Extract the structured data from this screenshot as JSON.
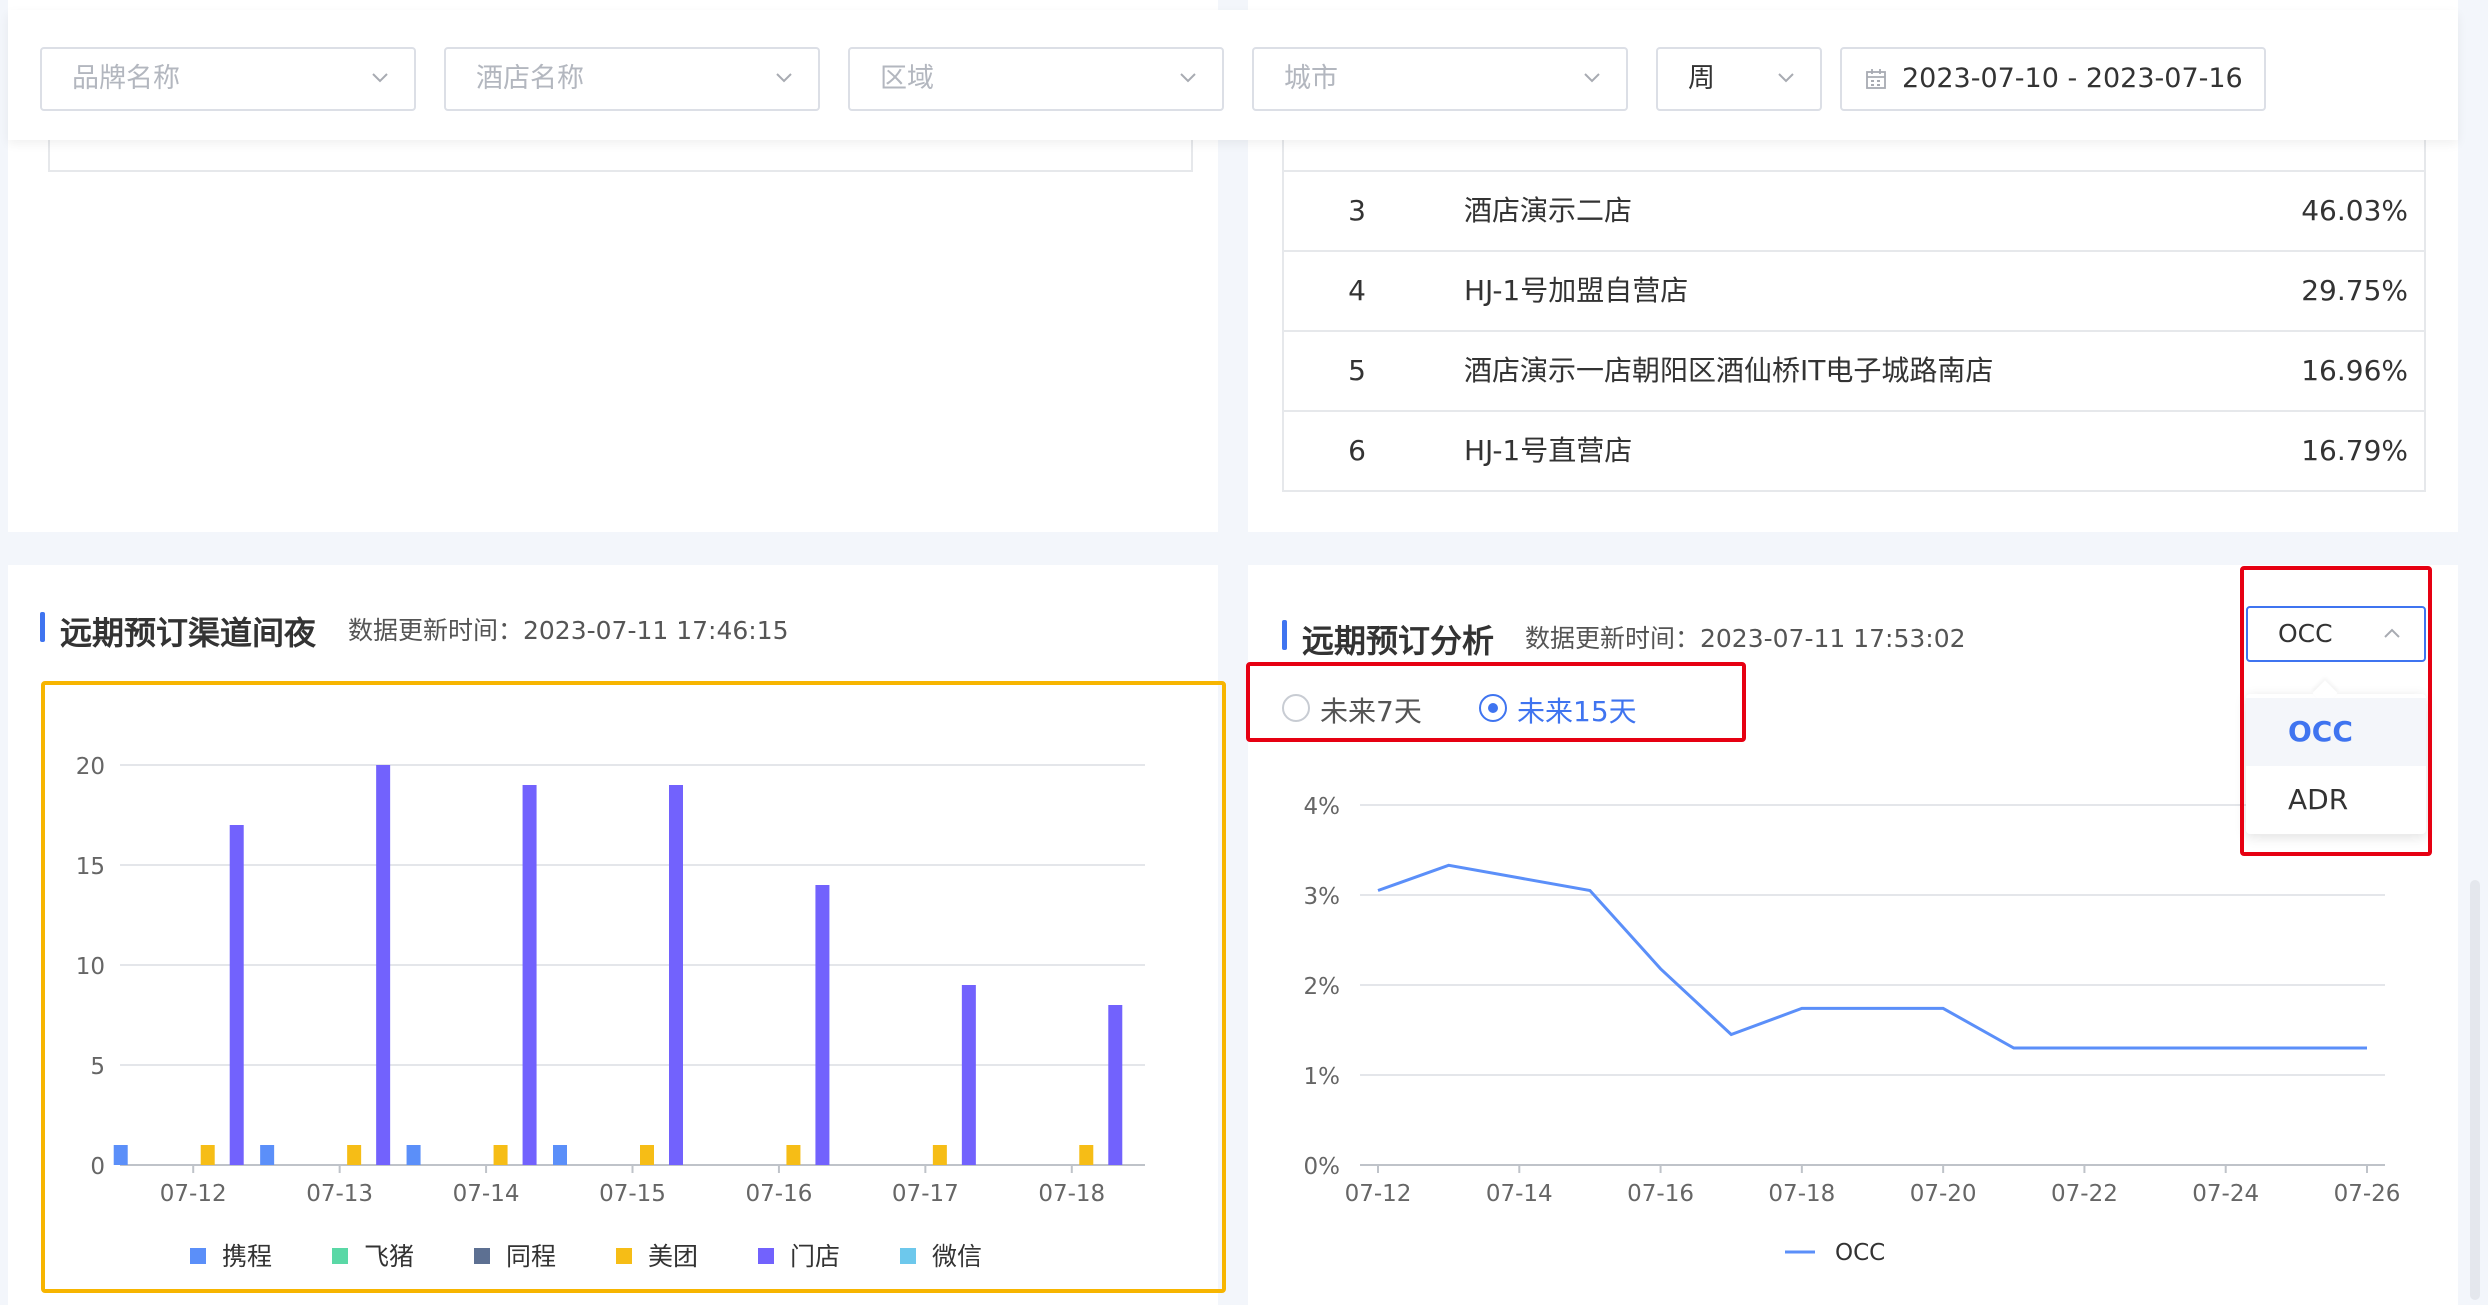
{
  "filters": {
    "brand_placeholder": "品牌名称",
    "hotel_placeholder": "酒店名称",
    "region_placeholder": "区域",
    "city_placeholder": "城市",
    "period_value": "周",
    "date_range": "2023-07-10 - 2023-07-16"
  },
  "ranking_table": {
    "rows": [
      {
        "rank": "3",
        "name": "酒店演示二店",
        "value": "46.03%"
      },
      {
        "rank": "4",
        "name": "HJ-1号加盟自营店",
        "value": "29.75%"
      },
      {
        "rank": "5",
        "name": "酒店演示一店朝阳区酒仙桥IT电子城路南店",
        "value": "16.96%"
      },
      {
        "rank": "6",
        "name": "HJ-1号直营店",
        "value": "16.79%"
      }
    ]
  },
  "channel_section": {
    "title": "远期预订渠道间夜",
    "update_time": "数据更新时间：2023-07-11 17:46:15"
  },
  "analysis_section": {
    "title": "远期预订分析",
    "update_time": "数据更新时间：2023-07-11 17:53:02",
    "radio_7": "未来7天",
    "radio_15": "未来15天",
    "selected_radio": "未来15天",
    "metric_selected": "OCC",
    "metric_options": [
      "OCC",
      "ADR"
    ]
  },
  "colors": {
    "accent": "#3f74f0",
    "highlight_yellow": "#f7b500",
    "highlight_red": "#e60012"
  },
  "chart_data": [
    {
      "type": "bar",
      "categories": [
        "07-12",
        "07-13",
        "07-14",
        "07-15",
        "07-16",
        "07-17",
        "07-18"
      ],
      "ylim": [
        0,
        20
      ],
      "yticks": [
        "0",
        "5",
        "10",
        "15",
        "20"
      ],
      "legend_position": "bottom",
      "grid": true,
      "series": [
        {
          "name": "携程",
          "color": "#5b8ff9",
          "values": [
            1,
            1,
            1,
            1,
            0,
            0,
            0
          ]
        },
        {
          "name": "飞猪",
          "color": "#5ad8a6",
          "values": [
            0,
            0,
            0,
            0,
            0,
            0,
            0
          ]
        },
        {
          "name": "同程",
          "color": "#5d7092",
          "values": [
            0,
            0,
            0,
            0,
            0,
            0,
            0
          ]
        },
        {
          "name": "美团",
          "color": "#f6bd16",
          "values": [
            1,
            1,
            1,
            1,
            1,
            1,
            1
          ]
        },
        {
          "name": "门店",
          "color": "#7262fd",
          "values": [
            17,
            20,
            19,
            19,
            14,
            9,
            8
          ]
        },
        {
          "name": "微信",
          "color": "#6dc8ec",
          "values": [
            0,
            0,
            0,
            0,
            0,
            0,
            0
          ]
        }
      ]
    },
    {
      "type": "line",
      "x": [
        "07-12",
        "07-13",
        "07-14",
        "07-15",
        "07-16",
        "07-17",
        "07-18",
        "07-19",
        "07-20",
        "07-21",
        "07-22",
        "07-23",
        "07-24",
        "07-25",
        "07-26"
      ],
      "xticks": [
        "07-12",
        "07-14",
        "07-16",
        "07-18",
        "07-20",
        "07-22",
        "07-24",
        "07-26"
      ],
      "ylim": [
        0,
        4
      ],
      "yticks": [
        "0%",
        "1%",
        "2%",
        "3%",
        "4%"
      ],
      "legend_position": "bottom",
      "grid": true,
      "series": [
        {
          "name": "OCC",
          "color": "#5b8ff9",
          "values": [
            3.05,
            3.33,
            3.19,
            3.05,
            2.18,
            1.45,
            1.74,
            1.74,
            1.74,
            1.3,
            1.3,
            1.3,
            1.3,
            1.3,
            1.3
          ]
        }
      ]
    }
  ]
}
